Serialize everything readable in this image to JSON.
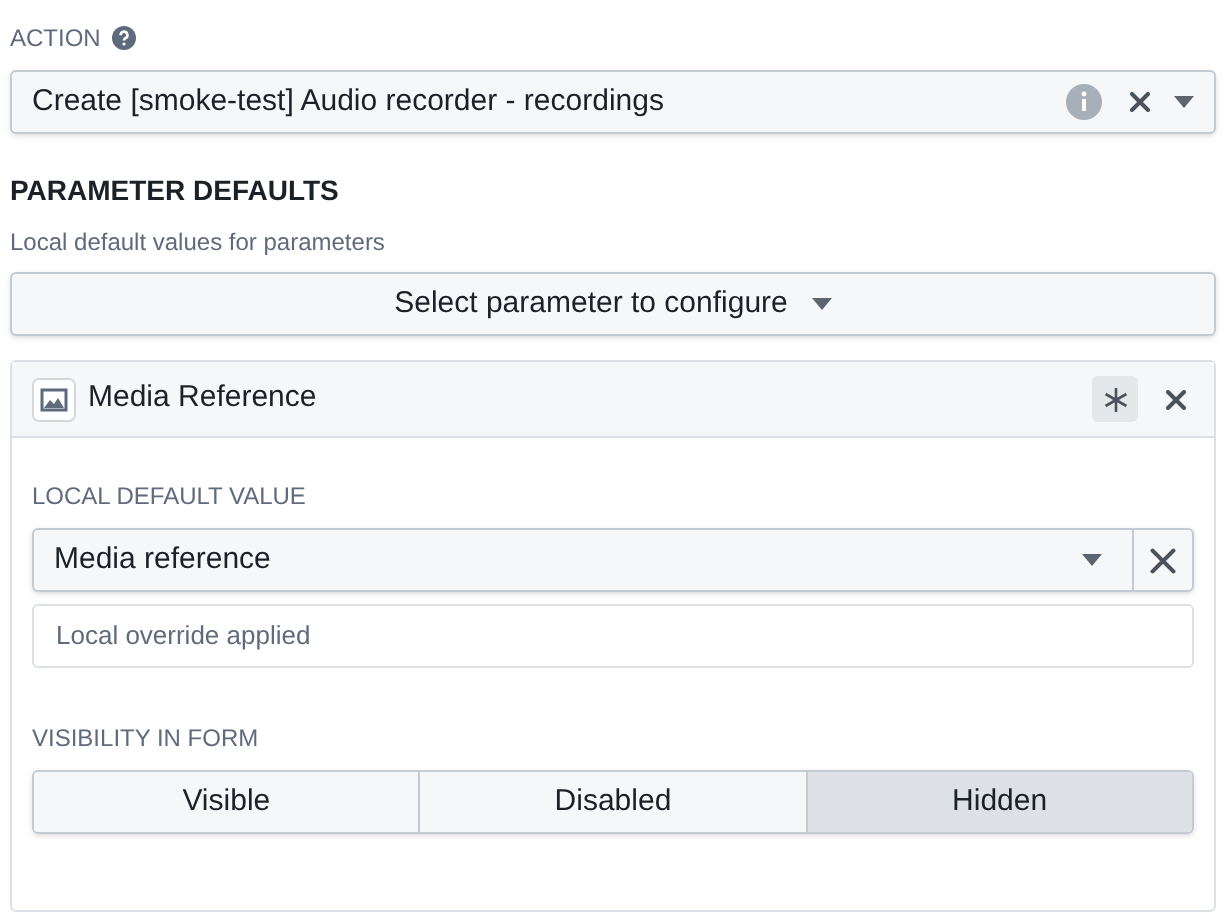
{
  "action": {
    "label": "ACTION",
    "value": "Create [smoke-test] Audio recorder - recordings"
  },
  "parameter_defaults": {
    "heading": "PARAMETER DEFAULTS",
    "subtitle": "Local default values for parameters",
    "select_button": "Select parameter to configure"
  },
  "parameter_card": {
    "title": "Media Reference",
    "required_toggle": {
      "on": true
    },
    "local_default": {
      "label": "LOCAL DEFAULT VALUE",
      "value": "Media reference",
      "note": "Local override applied"
    },
    "visibility": {
      "label": "VISIBILITY IN FORM",
      "options": [
        {
          "label": "Visible",
          "selected": false
        },
        {
          "label": "Disabled",
          "selected": false
        },
        {
          "label": "Hidden",
          "selected": true
        }
      ]
    }
  }
}
